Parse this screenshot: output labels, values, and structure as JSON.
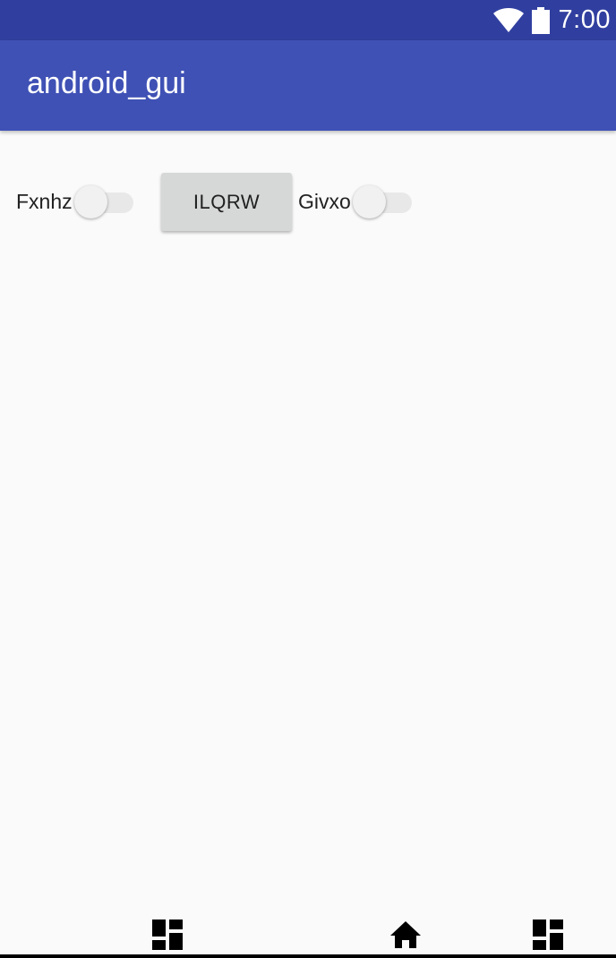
{
  "status_bar": {
    "time": "7:00",
    "icons": [
      "wifi-icon",
      "battery-icon"
    ]
  },
  "app_bar": {
    "title": "android_gui"
  },
  "controls": {
    "switch1": {
      "label": "Fxnhz",
      "checked": false
    },
    "button": {
      "label": "ILQRW"
    },
    "switch2": {
      "label": "Givxo",
      "checked": false
    }
  },
  "nav_bar": {
    "icons": [
      "dashboard-icon",
      "home-icon",
      "dashboard-icon"
    ]
  },
  "colors": {
    "status_bar": "#303f9f",
    "app_bar": "#3f51b5",
    "background": "#fafafa",
    "button": "#d6d7d7"
  }
}
